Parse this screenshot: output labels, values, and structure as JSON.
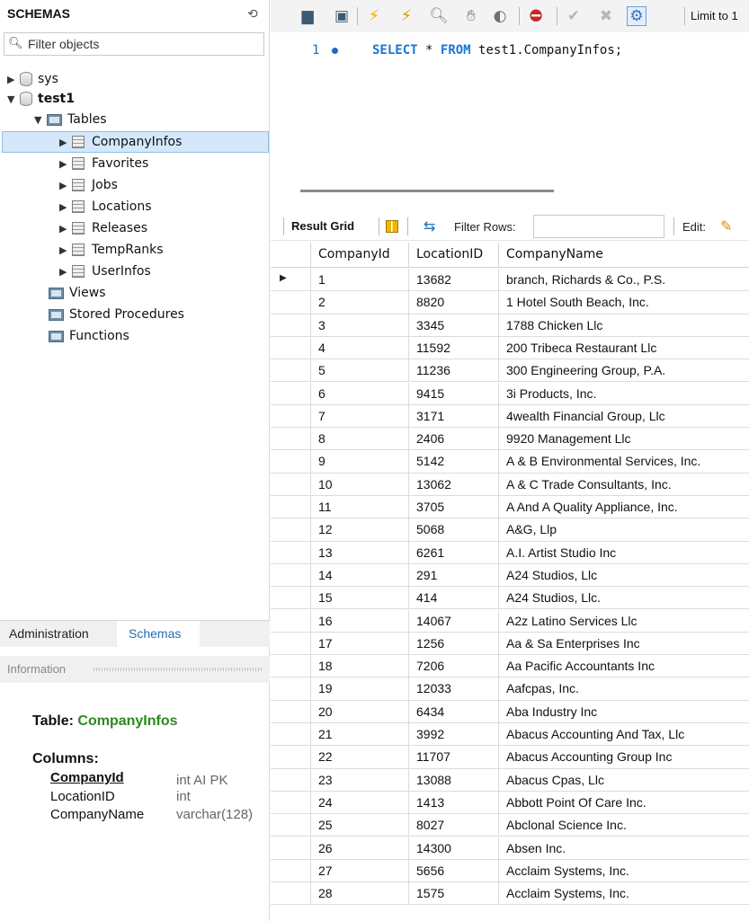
{
  "navigator": {
    "title": "SCHEMAS",
    "filter_placeholder": "Filter objects",
    "schemas": [
      {
        "name": "sys",
        "expanded": false
      },
      {
        "name": "test1",
        "expanded": true
      }
    ],
    "tables_label": "Tables",
    "tables": [
      "CompanyInfos",
      "Favorites",
      "Jobs",
      "Locations",
      "Releases",
      "TempRanks",
      "UserInfos"
    ],
    "selected_table": "CompanyInfos",
    "other_folders": [
      "Views",
      "Stored Procedures",
      "Functions"
    ]
  },
  "bottom_tabs": {
    "administration": "Administration",
    "schemas": "Schemas",
    "active": "Schemas"
  },
  "information": {
    "header": "Information",
    "table_label": "Table:",
    "table_name": "CompanyInfos",
    "columns_label": "Columns:",
    "columns": [
      {
        "name": "CompanyId",
        "type": "int AI PK"
      },
      {
        "name": "LocationID",
        "type": "int"
      },
      {
        "name": "CompanyName",
        "type": "varchar(128)"
      }
    ]
  },
  "toolbar": {
    "limit_label": "Limit to 1"
  },
  "editor": {
    "line_number": "1",
    "sql_keyword_select": "SELECT",
    "sql_star": "*",
    "sql_keyword_from": "FROM",
    "sql_target": "test1.CompanyInfos;"
  },
  "result": {
    "grid_label": "Result Grid",
    "filter_label": "Filter Rows:",
    "filter_value": "",
    "edit_label": "Edit:",
    "columns": [
      "CompanyId",
      "LocationID",
      "CompanyName"
    ],
    "rows": [
      [
        "1",
        "13682",
        "branch, Richards & Co., P.S."
      ],
      [
        "2",
        "8820",
        "1 Hotel South Beach, Inc."
      ],
      [
        "3",
        "3345",
        "1788 Chicken Llc"
      ],
      [
        "4",
        "11592",
        "200 Tribeca Restaurant Llc"
      ],
      [
        "5",
        "11236",
        "300 Engineering Group, P.A."
      ],
      [
        "6",
        "9415",
        "3i Products, Inc."
      ],
      [
        "7",
        "3171",
        "4wealth Financial Group, Llc"
      ],
      [
        "8",
        "2406",
        "9920 Management Llc"
      ],
      [
        "9",
        "5142",
        "A & B Environmental Services, Inc."
      ],
      [
        "10",
        "13062",
        "A & C Trade Consultants, Inc."
      ],
      [
        "11",
        "3705",
        "A And A Quality Appliance, Inc."
      ],
      [
        "12",
        "5068",
        "A&G, Llp"
      ],
      [
        "13",
        "6261",
        "A.I. Artist Studio Inc"
      ],
      [
        "14",
        "291",
        "A24 Studios, Llc"
      ],
      [
        "15",
        "414",
        "A24 Studios, Llc."
      ],
      [
        "16",
        "14067",
        "A2z Latino Services Llc"
      ],
      [
        "17",
        "1256",
        "Aa & Sa Enterprises Inc"
      ],
      [
        "18",
        "7206",
        "Aa Pacific Accountants Inc"
      ],
      [
        "19",
        "12033",
        "Aafcpas, Inc."
      ],
      [
        "20",
        "6434",
        "Aba Industry Inc"
      ],
      [
        "21",
        "3992",
        "Abacus Accounting And Tax, Llc"
      ],
      [
        "22",
        "11707",
        "Abacus Accounting Group Inc"
      ],
      [
        "23",
        "13088",
        "Abacus Cpas, Llc"
      ],
      [
        "24",
        "1413",
        "Abbott Point Of Care Inc."
      ],
      [
        "25",
        "8027",
        "Abclonal Science Inc."
      ],
      [
        "26",
        "14300",
        "Absen Inc."
      ],
      [
        "27",
        "5656",
        "Acclaim Systems, Inc."
      ],
      [
        "28",
        "1575",
        "Acclaim Systems, Inc."
      ]
    ]
  }
}
